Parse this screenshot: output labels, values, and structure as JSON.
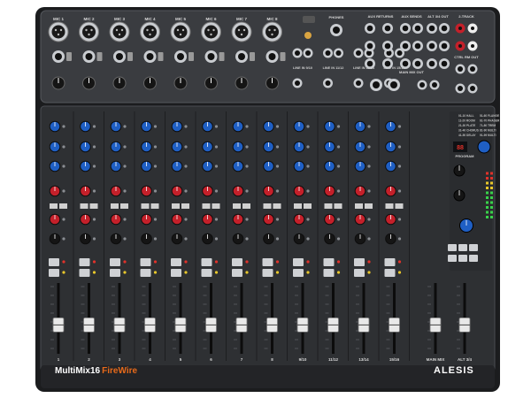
{
  "product": {
    "model": "MultiMix16",
    "model_suffix": "FireWire",
    "brand": "ALESIS"
  },
  "colors": {
    "chassis": "#2e3033",
    "top_panel": "#3a3c40",
    "knob_blue": "#1f5fc4",
    "knob_red": "#c4202a",
    "knob_black": "#151515",
    "fader_cap": "#e8e8e8",
    "led_green": "#39d24a",
    "led_yellow": "#e8c72a",
    "led_red": "#e0322a",
    "accent_orange": "#e86a1a"
  },
  "channels": {
    "mono_inputs": [
      "MIC 1",
      "MIC 2",
      "MIC 3",
      "MIC 4",
      "MIC 5",
      "MIC 6",
      "MIC 7",
      "MIC 8"
    ],
    "fader_labels": [
      "1",
      "2",
      "3",
      "4",
      "5",
      "6",
      "7",
      "8",
      "9/10",
      "11/12",
      "13/14",
      "15/16",
      "MAIN MIX",
      "ALT 3/4"
    ],
    "fader_levels": [
      0.42,
      0.42,
      0.42,
      0.42,
      0.42,
      0.42,
      0.42,
      0.42,
      0.42,
      0.42,
      0.42,
      0.42,
      0.42,
      0.42
    ]
  },
  "top_section": {
    "phones_label": "PHONES",
    "aux_returns_label": "AUX RETURNS",
    "aux_sends_label": "AUX SENDS",
    "alt_out_label": "ALT 3/4 OUT",
    "twotrack_label": "2-TRACK",
    "main_mix_out_label": "MAIN MIX OUT",
    "ctrl_out_label": "CTRL RM OUT",
    "stereo_line_labels": [
      "LINE IN 9/10",
      "LINE IN 11/12",
      "LINE IN 13/14",
      "LINE IN 15/16"
    ]
  },
  "master": {
    "effects_label": "PROGRAM",
    "fx_list": [
      "01-10 HALL",
      "11-20 ROOM",
      "21-30 PLATE",
      "31-40 CHORUS",
      "41-50 DELAY",
      "51-60 FLANGE",
      "61-70 PHASER",
      "71-80 TREM",
      "81-90 MULTI",
      "91-99 MULTI"
    ]
  }
}
